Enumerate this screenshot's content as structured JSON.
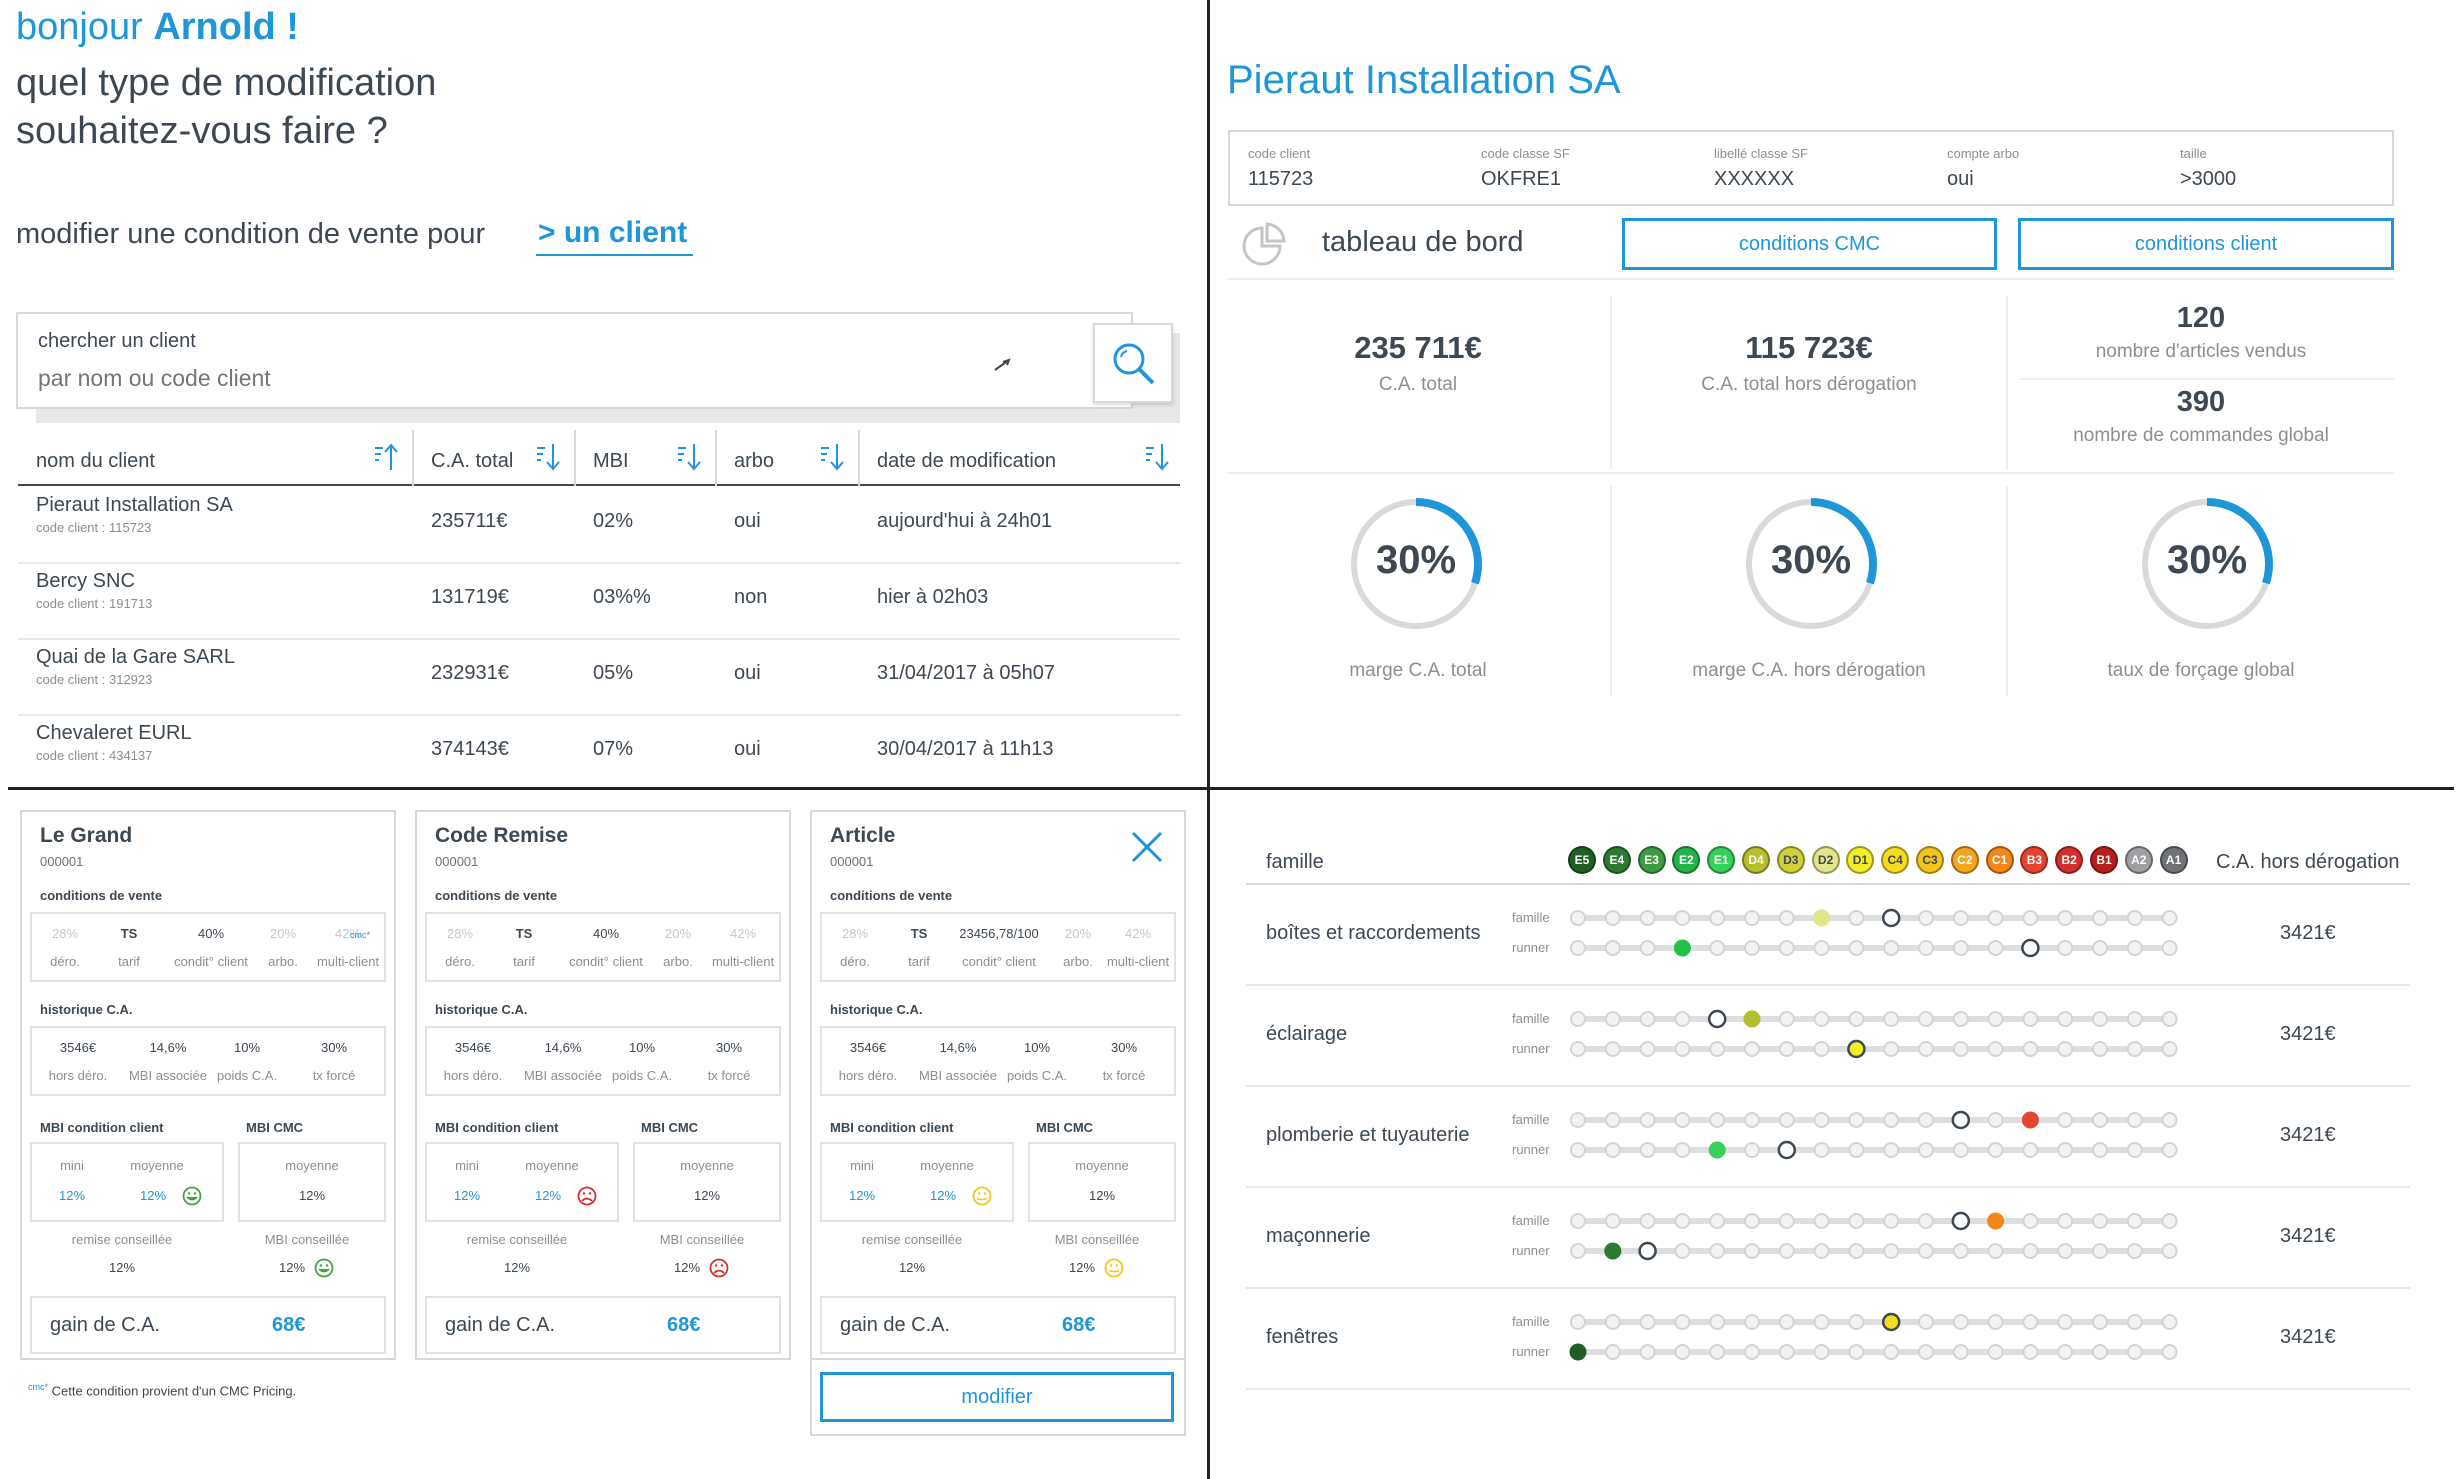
{
  "greeting": {
    "hello": "bonjour",
    "name": "Arnold !"
  },
  "question": {
    "line1": "quel type de modification",
    "line2": "souhaitez-vous faire ?"
  },
  "modify": {
    "label": "modifier une condition de vente pour",
    "choice": "> un client"
  },
  "search": {
    "label": "chercher un client",
    "placeholder": "par nom ou code client"
  },
  "table": {
    "headers": [
      "nom du client",
      "C.A. total",
      "MBI",
      "arbo",
      "date de modification"
    ],
    "rows": [
      {
        "name": "Pieraut Installation SA",
        "code": "code client : 115723",
        "ca": "235711€",
        "mbi": "02%",
        "arbo": "oui",
        "date": "aujourd'hui à 24h01"
      },
      {
        "name": "Bercy SNC",
        "code": "code client : 191713",
        "ca": "131719€",
        "mbi": "03%%",
        "arbo": "non",
        "date": "hier à 02h03"
      },
      {
        "name": "Quai de la Gare SARL",
        "code": "code client : 312923",
        "ca": "232931€",
        "mbi": "05%",
        "arbo": "oui",
        "date": "31/04/2017 à 05h07"
      },
      {
        "name": "Chevaleret EURL",
        "code": "code client : 434137",
        "ca": "374143€",
        "mbi": "07%",
        "arbo": "oui",
        "date": "30/04/2017 à 11h13"
      }
    ]
  },
  "client": {
    "title": "Pieraut Installation SA",
    "info": [
      {
        "label": "code client",
        "value": "115723"
      },
      {
        "label": "code classe SF",
        "value": "OKFRE1"
      },
      {
        "label": "libellé classe SF",
        "value": "XXXXXX"
      },
      {
        "label": "compte arbo",
        "value": "oui"
      },
      {
        "label": "taille",
        "value": ">3000"
      }
    ],
    "dashboard_label": "tableau de bord",
    "btn_cmc": "conditions CMC",
    "btn_client": "conditions client",
    "kpis": [
      {
        "value": "235 711€",
        "label": "C.A. total"
      },
      {
        "value": "115 723€",
        "label": "C.A. total hors dérogation"
      },
      {
        "value": "120",
        "label": "nombre d'articles vendus"
      },
      {
        "value": "390",
        "label": "nombre de commandes global"
      }
    ],
    "gauges": [
      {
        "value": "30%",
        "fraction": 0.3,
        "label": "marge C.A. total"
      },
      {
        "value": "30%",
        "fraction": 0.3,
        "label": "marge C.A. hors dérogation"
      },
      {
        "value": "30%",
        "fraction": 0.3,
        "label": "taux de forçage global"
      }
    ]
  },
  "cards": [
    {
      "title": "Le Grand",
      "code": "000001",
      "cv_values": [
        "28%",
        "TS",
        "40%",
        "20%",
        "42%"
      ],
      "cmc_mark": "cmc*",
      "mood_moy": "happy",
      "mood_mbi": "happy"
    },
    {
      "title": "Code Remise",
      "code": "000001",
      "cv_values": [
        "28%",
        "TS",
        "40%",
        "20%",
        "42%"
      ],
      "cmc_mark": "",
      "mood_moy": "sad",
      "mood_mbi": "sad"
    },
    {
      "title": "Article",
      "code": "000001",
      "cv_values": [
        "28%",
        "TS",
        "23456,78/100",
        "20%",
        "42%"
      ],
      "cmc_mark": "",
      "mood_moy": "neutral",
      "mood_mbi": "neutral"
    }
  ],
  "card_labels": {
    "conditions": "conditions de vente",
    "cv_labels": [
      "déro.",
      "tarif",
      "condit° client",
      "arbo.",
      "multi-client"
    ],
    "historique": "historique C.A.",
    "hist_values": [
      "3546€",
      "14,6%",
      "10%",
      "30%"
    ],
    "hist_labels": [
      "hors déro.",
      "MBI associée",
      "poids C.A.",
      "tx forcé"
    ],
    "mbi_client": "MBI condition client",
    "mbi_cmc": "MBI CMC",
    "mini": "mini",
    "moyenne": "moyenne",
    "mini_val": "12%",
    "moy_val": "12%",
    "cmc_moy_val": "12%",
    "remise": "remise conseillée",
    "remise_val": "12%",
    "mbi_conseillee": "MBI conseillée",
    "mbi_conseillee_val": "12%",
    "gain": "gain de C.A.",
    "gain_val": "68€"
  },
  "modifier_btn": "modifier",
  "footnote": {
    "mark": "cmc*",
    "text": "Cette condition provient d'un CMC Pricing."
  },
  "famille": {
    "header": "famille",
    "right_header": "C.A. hors dérogation",
    "grades": [
      {
        "code": "E5",
        "color": "#1f5e24"
      },
      {
        "code": "E4",
        "color": "#2d7a32"
      },
      {
        "code": "E3",
        "color": "#3e9a43"
      },
      {
        "code": "E2",
        "color": "#23b34a"
      },
      {
        "code": "E1",
        "color": "#35d15a"
      },
      {
        "code": "D4",
        "color": "#b6bf2c"
      },
      {
        "code": "D3",
        "color": "#cfd23a"
      },
      {
        "code": "D2",
        "color": "#e2e58a"
      },
      {
        "code": "D1",
        "color": "#f2ee2a"
      },
      {
        "code": "C4",
        "color": "#f5dc20"
      },
      {
        "code": "C3",
        "color": "#f2c51c"
      },
      {
        "code": "C2",
        "color": "#f3a61e"
      },
      {
        "code": "C1",
        "color": "#f2871a"
      },
      {
        "code": "B3",
        "color": "#e5452e"
      },
      {
        "code": "B2",
        "color": "#d2302c"
      },
      {
        "code": "B1",
        "color": "#b71f1f"
      },
      {
        "code": "A2",
        "color": "#9ea0a3"
      },
      {
        "code": "A1",
        "color": "#6f7276"
      }
    ],
    "sub_famille": "famille",
    "sub_runner": "runner",
    "rows": [
      {
        "name": "boîtes et raccordements",
        "value": "3421€",
        "fam_fill": 7,
        "fam_fill_color": "#e2e58a",
        "fam_ring": 9,
        "run_fill": 3,
        "run_fill_color": "#23c04a",
        "run_ring": 13
      },
      {
        "name": "éclairage",
        "value": "3421€",
        "fam_fill": 5,
        "fam_fill_color": "#b6bf2c",
        "fam_ring": 4,
        "run_fill": 8,
        "run_fill_color": "#f2ee2a",
        "run_ring": 8
      },
      {
        "name": "plomberie et tuyauterie",
        "value": "3421€",
        "fam_fill": 13,
        "fam_fill_color": "#e5452e",
        "fam_ring": 11,
        "run_fill": 4,
        "run_fill_color": "#35d15a",
        "run_ring": 6
      },
      {
        "name": "maçonnerie",
        "value": "3421€",
        "fam_fill": 12,
        "fam_fill_color": "#f2871a",
        "fam_ring": 11,
        "run_fill": 1,
        "run_fill_color": "#2d7a32",
        "run_ring": 2
      },
      {
        "name": "fenêtres",
        "value": "3421€",
        "fam_fill": 9,
        "fam_fill_color": "#f5dc20",
        "fam_ring": 9,
        "run_fill": 0,
        "run_fill_color": "#1f5e24",
        "run_ring": -1
      }
    ]
  }
}
